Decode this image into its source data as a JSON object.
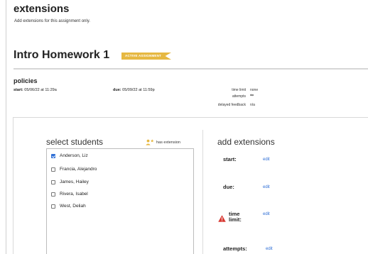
{
  "header": {
    "title": "extensions",
    "subtitle": "Add extensions for this assignment only."
  },
  "assignment": {
    "title": "Intro Homework 1",
    "badge": "ACTIVE ASSIGNMENT",
    "badge_color": "#e6b842"
  },
  "policies": {
    "title": "policies",
    "start_label": "start:",
    "start_value": "05/06/22 at 11:29a",
    "due_label": "due:",
    "due_value": "05/09/22 at 11:59p",
    "time_limit_label": "time limit",
    "time_limit_value": "none",
    "attempts_label": "attempts",
    "attempts_value": "∞",
    "feedback_label": "delayed feedback",
    "feedback_value": "n/a"
  },
  "select_students": {
    "title": "select students",
    "legend": "has extension",
    "items": [
      {
        "name": "Anderson, Liz",
        "checked": true
      },
      {
        "name": "Francia, Alejandro",
        "checked": false
      },
      {
        "name": "James, Hailey",
        "checked": false
      },
      {
        "name": "Rivera, Isabel",
        "checked": false
      },
      {
        "name": "West, Deliah",
        "checked": false
      }
    ]
  },
  "add_extensions": {
    "title": "add extensions",
    "start_label": "start:",
    "due_label": "due:",
    "time_label_1": "time",
    "time_label_2": "limit:",
    "attempts_label": "attempts:",
    "edit_label": "edit",
    "link_color": "#2f6fd6",
    "warning_color": "#d83a34"
  },
  "icons": {
    "legend_icon": "person-star-icon",
    "warning_icon": "warning-triangle-icon",
    "check_icon": "check-icon"
  }
}
